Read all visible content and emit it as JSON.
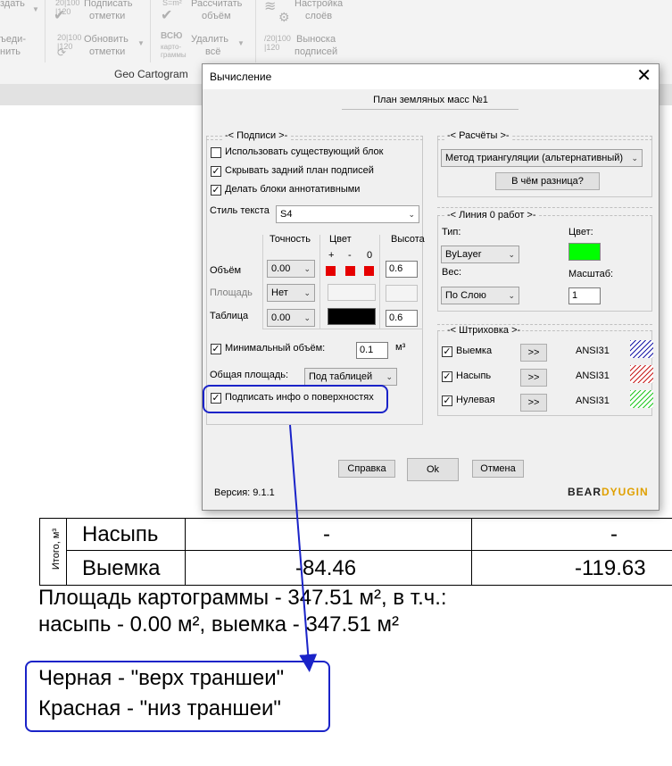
{
  "ribbon": {
    "items": [
      {
        "line1": "здать",
        "line2": ""
      },
      {
        "line1": "Подписать",
        "line2": "отметки"
      },
      {
        "line1": "Рассчитать",
        "line2": "объём"
      },
      {
        "line1": "Настройка",
        "line2": "слоёв"
      },
      {
        "line1": "ъеди-",
        "line2": "нить"
      },
      {
        "line1": "Обновить",
        "line2": "отметки"
      },
      {
        "line1": "Удалить",
        "line2": "всё"
      },
      {
        "line1": "Выноска",
        "line2": "подписей"
      }
    ],
    "icon_labels": {
      "num": "20|100\n|120",
      "all": "ВСЮ",
      "cartogram": "карто-\nграммы"
    },
    "group_label": "Geo Cartogram"
  },
  "dialog": {
    "title": "Вычисление",
    "close": "✕",
    "name_field": "План земляных масс №1",
    "captions": {
      "group_captions": "-<  Подписи  >-",
      "use_existing": "Использовать существующий блок",
      "hide_background": "Скрывать задний план подписей",
      "annotative": "Делать блоки аннотативными",
      "text_style_label": "Стиль текста",
      "text_style_value": "S4",
      "col_precision": "Точность",
      "col_color": "Цвет",
      "col_height": "Высота",
      "color_signs": [
        "+",
        "-",
        "0"
      ],
      "rows": [
        {
          "label": "Объём",
          "precision": "0.00",
          "height": "0.6",
          "enabled": true
        },
        {
          "label": "Площадь",
          "precision": "Нет",
          "height": "",
          "enabled": false
        },
        {
          "label": "Таблица",
          "precision": "0.00",
          "height": "0.6",
          "enabled": true
        }
      ],
      "min_volume_label": "Минимальный объём:",
      "min_volume_value": "0.1",
      "min_volume_unit": "м³",
      "total_area_label": "Общая площадь:",
      "total_area_value": "Под таблицей",
      "surface_info": "Подписать инфо о поверхностях"
    },
    "calc": {
      "group_title": "-<  Расчёты  >-",
      "method": "Метод триангуляции (альтернативный)",
      "diff_button": "В чём разница?"
    },
    "zero_line": {
      "group_title": "-<  Линия 0 работ  >-",
      "type_label": "Тип:",
      "type_value": "ByLayer",
      "color_label": "Цвет:",
      "color_hex": "#00ff00",
      "weight_label": "Вес:",
      "weight_value": "По Слою",
      "scale_label": "Масштаб:",
      "scale_value": "1"
    },
    "hatch": {
      "group_title": "-<  Штриховка  >-",
      "rows": [
        {
          "label": "Выемка",
          "button": ">>",
          "pattern": "ANSI31",
          "color": "#1a1aa8"
        },
        {
          "label": "Насыпь",
          "button": ">>",
          "pattern": "ANSI31",
          "color": "#c81e1e"
        },
        {
          "label": "Нулевая",
          "button": ">>",
          "pattern": "ANSI31",
          "color": "#22c822"
        }
      ]
    },
    "buttons": {
      "help": "Справка",
      "ok": "Ok",
      "cancel": "Отмена"
    },
    "version": "Версия: 9.1.1",
    "brand_a": "BEAR",
    "brand_b": "DYUGIN"
  },
  "table": {
    "side_label": "Итого, м³",
    "rows": [
      {
        "label": "Насыпь",
        "v1": "-",
        "v2": "-"
      },
      {
        "label": "Выемка",
        "v1": "-84.46",
        "v2": "-119.63"
      }
    ]
  },
  "summary": {
    "line1": "Площадь картограммы - 347.51 м², в т.ч.:",
    "line2": "насыпь - 0.00 м², выемка - 347.51 м²",
    "line3": "Черная - \"верх траншеи\"",
    "line4": "Красная - \"низ траншеи\""
  },
  "colors": {
    "highlight": "#1a23c8",
    "swatch_red": "#e60000",
    "black": "#000000"
  }
}
